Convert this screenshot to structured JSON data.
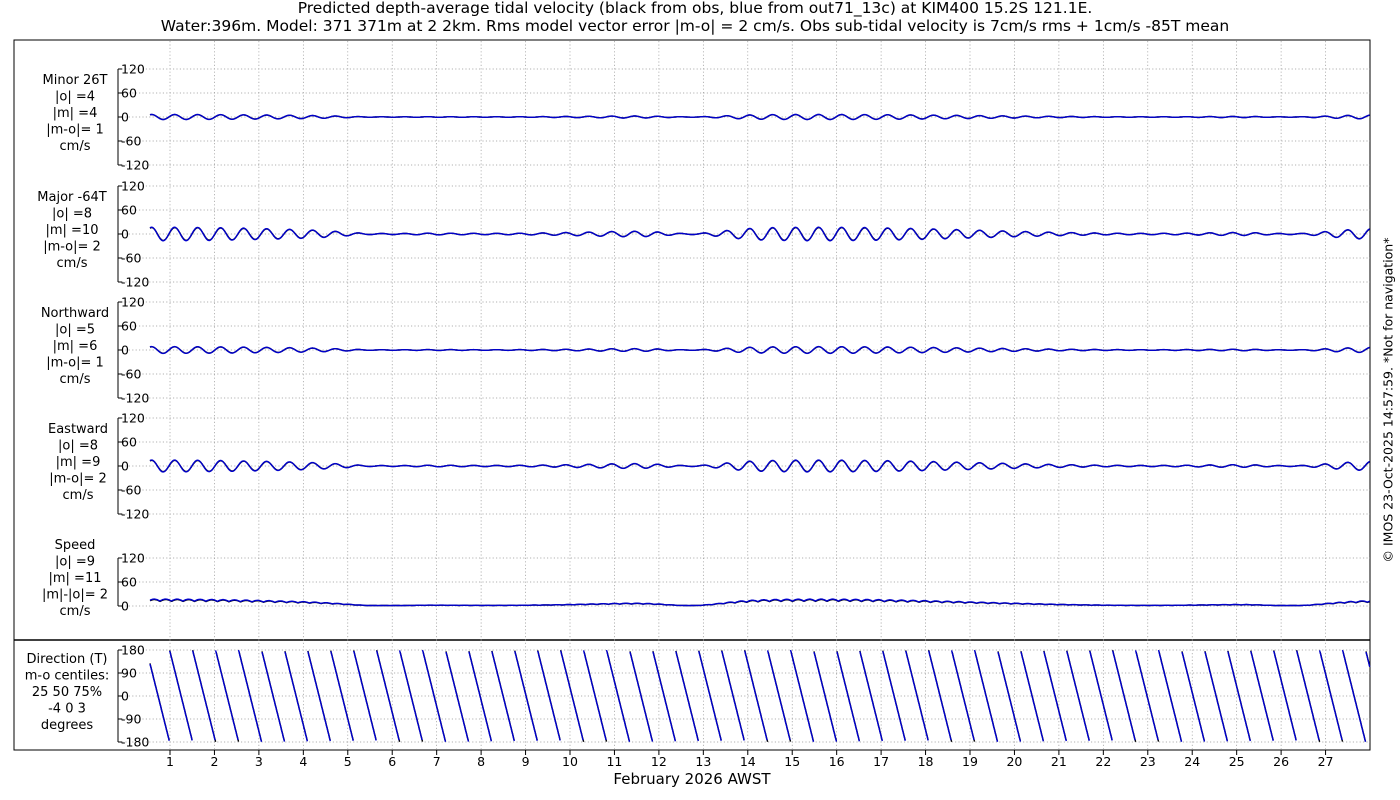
{
  "title_line1": "Predicted depth-average tidal velocity (black from obs, blue from out71_13c) at KIM400 15.2S 121.1E.",
  "title_line2": "Water:396m. Model: 371 371m at 2 2km. Rms model vector error |m-o| = 2 cm/s. Obs sub-tidal velocity is 7cm/s rms + 1cm/s -85T mean",
  "credit": "© IMOS 23-Oct-2025 14:57:59. *Not for navigation*",
  "colors": {
    "obs": "#000000",
    "model": "#0000cc",
    "grid": "#999999"
  },
  "chart_data": {
    "type": "line",
    "xlabel": "February 2026 AWST",
    "x_ticks": [
      "1",
      "2",
      "3",
      "4",
      "5",
      "6",
      "7",
      "8",
      "9",
      "10",
      "11",
      "12",
      "13",
      "14",
      "15",
      "16",
      "17",
      "18",
      "19",
      "20",
      "21",
      "22",
      "23",
      "24",
      "25",
      "26",
      "27"
    ],
    "xlim": [
      0.55,
      28.0
    ],
    "grid": "dotted",
    "series_legend": [
      {
        "name": "obs",
        "color": "#000000"
      },
      {
        "name": "out71_13c",
        "color": "#0000cc"
      }
    ],
    "panels": [
      {
        "id": "minor",
        "label_lines": [
          "Minor 26T",
          "|o| =4",
          "|m| =4",
          "|m-o|= 1",
          "cm/s"
        ],
        "ylim": [
          -120,
          120
        ],
        "yticks": [
          "120",
          "60",
          "0",
          "-60",
          "-120"
        ],
        "ytick_values": [
          120,
          60,
          0,
          -60,
          -120
        ],
        "amplitude": 6,
        "kind": "velocity"
      },
      {
        "id": "major",
        "label_lines": [
          "Major -64T",
          "|o| =8",
          "|m| =10",
          "|m-o|= 2",
          "cm/s"
        ],
        "ylim": [
          -120,
          120
        ],
        "yticks": [
          "120",
          "60",
          "0",
          "-60",
          "-120"
        ],
        "ytick_values": [
          120,
          60,
          0,
          -60,
          -120
        ],
        "amplitude": 16,
        "kind": "velocity"
      },
      {
        "id": "northward",
        "label_lines": [
          "Northward",
          "|o| =5",
          "|m| =6",
          "|m-o|= 1",
          "cm/s"
        ],
        "ylim": [
          -120,
          120
        ],
        "yticks": [
          "120",
          "60",
          "0",
          "-60",
          "-120"
        ],
        "ytick_values": [
          120,
          60,
          0,
          -60,
          -120
        ],
        "amplitude": 8,
        "kind": "velocity"
      },
      {
        "id": "eastward",
        "label_lines": [
          "Eastward",
          "|o| =8",
          "|m| =9",
          "|m-o|= 2",
          "cm/s"
        ],
        "ylim": [
          -120,
          120
        ],
        "yticks": [
          "120",
          "60",
          "0",
          "-60",
          "-120"
        ],
        "ytick_values": [
          120,
          60,
          0,
          -60,
          -120
        ],
        "amplitude": 14,
        "kind": "velocity"
      },
      {
        "id": "speed",
        "label_lines": [
          "Speed",
          "|o| =9",
          "|m| =11",
          "|m|-|o|= 2",
          "cm/s"
        ],
        "ylim": [
          0,
          120
        ],
        "yticks": [
          "120",
          "60",
          "0"
        ],
        "ytick_values": [
          120,
          60,
          0
        ],
        "amplitude": 16,
        "kind": "speed"
      },
      {
        "id": "direction",
        "label_lines": [
          "Direction (T)",
          "m-o centiles:",
          "25  50  75%",
          "-4  0  3",
          "degrees"
        ],
        "ylim": [
          -180,
          180
        ],
        "yticks": [
          "180",
          "90",
          "0",
          "-90",
          "-180"
        ],
        "ytick_values": [
          180,
          90,
          0,
          -90,
          -180
        ],
        "kind": "direction"
      }
    ],
    "tidal_model": {
      "semidiurnal_period_days": 0.5175,
      "spring_neap_period_days": 14.77,
      "neap_centres_days": [
        5.8,
        12.7,
        26.2
      ]
    }
  }
}
